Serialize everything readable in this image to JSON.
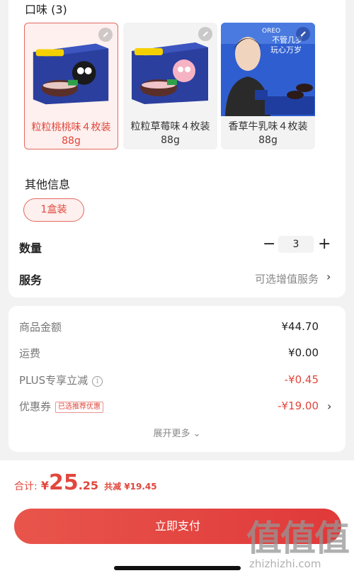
{
  "flavor_section": {
    "title": "口味 (3)",
    "options": [
      {
        "label": "粒粒桃桃味４枚装88g",
        "selected": true
      },
      {
        "label": "粒粒草莓味４枚装88g",
        "selected": false
      },
      {
        "label": "香草牛乳味４枚装88g",
        "selected": false
      }
    ],
    "poster_text": [
      "不管几岁",
      "玩心万岁"
    ]
  },
  "other_info": {
    "title": "其他信息",
    "option": "1盒装"
  },
  "quantity": {
    "label": "数量",
    "value": "3"
  },
  "service": {
    "label": "服务",
    "value": "可选增值服务"
  },
  "fees": {
    "goods_label": "商品金额",
    "goods_value": "¥44.70",
    "shipping_label": "运费",
    "shipping_value": "¥0.00",
    "plus_label": "PLUS专享立减",
    "plus_value": "-¥0.45",
    "coupon_label": "优惠券",
    "coupon_tag": "已选推荐优惠",
    "coupon_value": "-¥19.00",
    "expand_more": "展开更多"
  },
  "total": {
    "label": "合计:",
    "currency": "¥",
    "int": "25",
    "dec": ".25",
    "saved": "共减 ¥19.45"
  },
  "pay_button": "立即支付",
  "watermark": {
    "big": "值值值",
    "small": "zhizhizhi.com"
  },
  "colors": {
    "accent": "#e1473d",
    "accent_light": "#fdf0ee",
    "box_blue": "#2b3f9e"
  }
}
